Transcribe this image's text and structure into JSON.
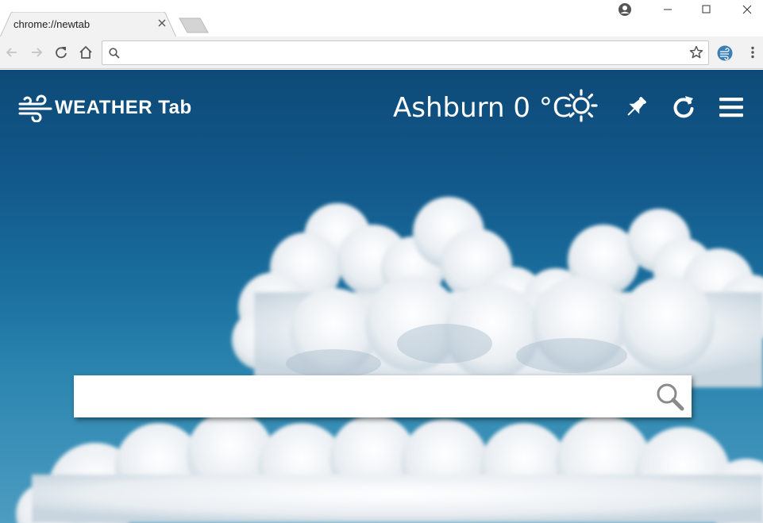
{
  "browser": {
    "tab_title": "chrome://newtab",
    "omnibox": {
      "value": "",
      "placeholder": ""
    }
  },
  "app": {
    "logo_bold": "WEATHER",
    "logo_rest": " Tab",
    "weather": {
      "city": "Ashburn",
      "temperature": "0 °C"
    },
    "search": {
      "value": "",
      "placeholder": ""
    }
  },
  "icons": {
    "weather_condition": "sun-icon",
    "toolbar": [
      "pin-icon",
      "refresh-icon",
      "hamburger-icon"
    ]
  },
  "colors": {
    "sky_top": "#0d4a78",
    "sky_bottom": "#4d9cc1",
    "text": "#ffffff",
    "chrome_toolbar": "#f2f2f2"
  }
}
